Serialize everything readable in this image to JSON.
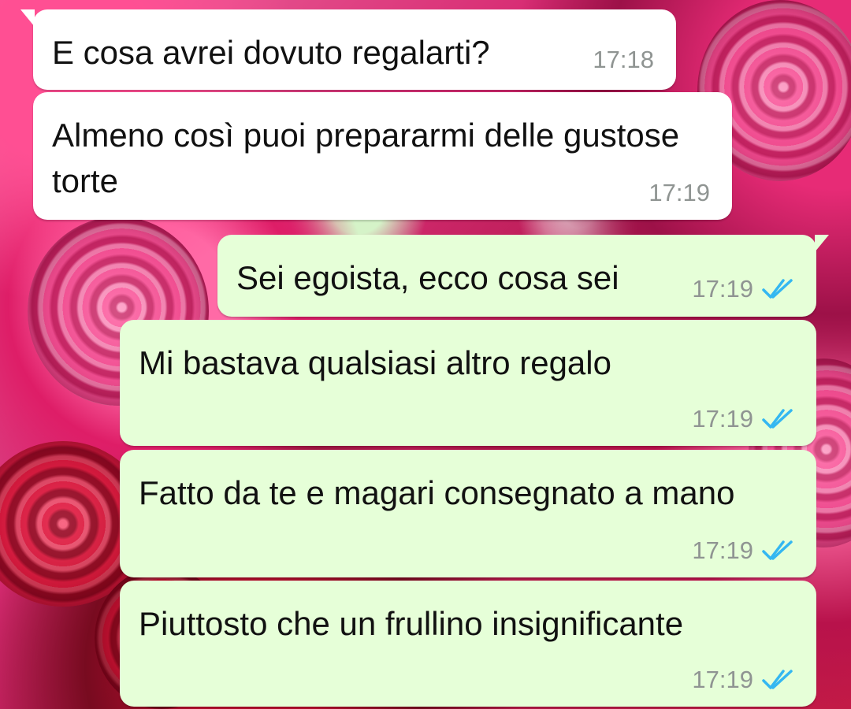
{
  "messages": [
    {
      "text": "E cosa avrei dovuto regalarti?",
      "time": "17:18",
      "direction": "incoming"
    },
    {
      "text": "Almeno così puoi prepararmi delle gustose torte",
      "time": "17:19",
      "direction": "incoming"
    },
    {
      "text": "Sei egoista, ecco cosa sei",
      "time": "17:19",
      "direction": "outgoing",
      "status": "read",
      "status_icon": "double-check-icon"
    },
    {
      "text": "Mi bastava qualsiasi altro regalo",
      "time": "17:19",
      "direction": "outgoing",
      "status": "read",
      "status_icon": "double-check-icon"
    },
    {
      "text": "Fatto da te e magari consegnato a mano",
      "time": "17:19",
      "direction": "outgoing",
      "status": "read",
      "status_icon": "double-check-icon"
    },
    {
      "text": "Piuttosto che un frullino insignificante",
      "time": "17:19",
      "direction": "outgoing",
      "status": "read",
      "status_icon": "double-check-icon"
    }
  ],
  "colors": {
    "incoming_bubble": "#ffffff",
    "outgoing_bubble": "#e6ffd8",
    "timestamp": "#8f9492",
    "read_check": "#34b7f1"
  },
  "background": {
    "theme": "roses"
  }
}
